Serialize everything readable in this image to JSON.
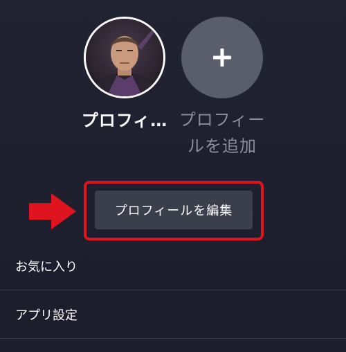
{
  "profiles": {
    "user_name": "プロフィ…",
    "add_label": "プロフィールを追加"
  },
  "actions": {
    "edit_profile": "プロフィールを編集"
  },
  "menu": {
    "items": [
      {
        "label": "お気に入り"
      },
      {
        "label": "アプリ設定"
      }
    ]
  },
  "colors": {
    "background": "#1f2131",
    "highlight": "#e0141e",
    "button": "#3b3e4b",
    "add_circle": "#5a5d6c",
    "muted_text": "#8a8d9b"
  },
  "icons": {
    "add": "plus-icon",
    "annotation": "red-arrow-icon"
  }
}
